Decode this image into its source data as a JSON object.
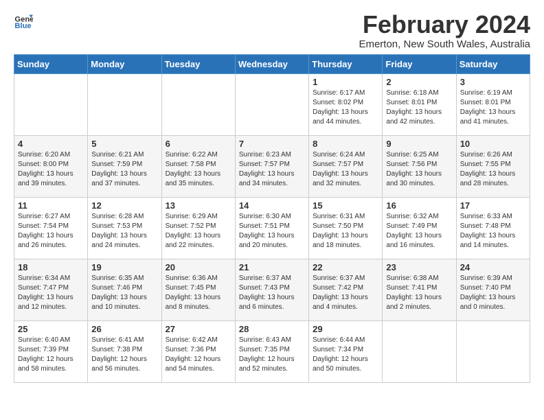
{
  "header": {
    "logo_general": "General",
    "logo_blue": "Blue",
    "month_title": "February 2024",
    "location": "Emerton, New South Wales, Australia"
  },
  "calendar": {
    "days_of_week": [
      "Sunday",
      "Monday",
      "Tuesday",
      "Wednesday",
      "Thursday",
      "Friday",
      "Saturday"
    ],
    "weeks": [
      [
        {
          "day": "",
          "info": ""
        },
        {
          "day": "",
          "info": ""
        },
        {
          "day": "",
          "info": ""
        },
        {
          "day": "",
          "info": ""
        },
        {
          "day": "1",
          "info": "Sunrise: 6:17 AM\nSunset: 8:02 PM\nDaylight: 13 hours\nand 44 minutes."
        },
        {
          "day": "2",
          "info": "Sunrise: 6:18 AM\nSunset: 8:01 PM\nDaylight: 13 hours\nand 42 minutes."
        },
        {
          "day": "3",
          "info": "Sunrise: 6:19 AM\nSunset: 8:01 PM\nDaylight: 13 hours\nand 41 minutes."
        }
      ],
      [
        {
          "day": "4",
          "info": "Sunrise: 6:20 AM\nSunset: 8:00 PM\nDaylight: 13 hours\nand 39 minutes."
        },
        {
          "day": "5",
          "info": "Sunrise: 6:21 AM\nSunset: 7:59 PM\nDaylight: 13 hours\nand 37 minutes."
        },
        {
          "day": "6",
          "info": "Sunrise: 6:22 AM\nSunset: 7:58 PM\nDaylight: 13 hours\nand 35 minutes."
        },
        {
          "day": "7",
          "info": "Sunrise: 6:23 AM\nSunset: 7:57 PM\nDaylight: 13 hours\nand 34 minutes."
        },
        {
          "day": "8",
          "info": "Sunrise: 6:24 AM\nSunset: 7:57 PM\nDaylight: 13 hours\nand 32 minutes."
        },
        {
          "day": "9",
          "info": "Sunrise: 6:25 AM\nSunset: 7:56 PM\nDaylight: 13 hours\nand 30 minutes."
        },
        {
          "day": "10",
          "info": "Sunrise: 6:26 AM\nSunset: 7:55 PM\nDaylight: 13 hours\nand 28 minutes."
        }
      ],
      [
        {
          "day": "11",
          "info": "Sunrise: 6:27 AM\nSunset: 7:54 PM\nDaylight: 13 hours\nand 26 minutes."
        },
        {
          "day": "12",
          "info": "Sunrise: 6:28 AM\nSunset: 7:53 PM\nDaylight: 13 hours\nand 24 minutes."
        },
        {
          "day": "13",
          "info": "Sunrise: 6:29 AM\nSunset: 7:52 PM\nDaylight: 13 hours\nand 22 minutes."
        },
        {
          "day": "14",
          "info": "Sunrise: 6:30 AM\nSunset: 7:51 PM\nDaylight: 13 hours\nand 20 minutes."
        },
        {
          "day": "15",
          "info": "Sunrise: 6:31 AM\nSunset: 7:50 PM\nDaylight: 13 hours\nand 18 minutes."
        },
        {
          "day": "16",
          "info": "Sunrise: 6:32 AM\nSunset: 7:49 PM\nDaylight: 13 hours\nand 16 minutes."
        },
        {
          "day": "17",
          "info": "Sunrise: 6:33 AM\nSunset: 7:48 PM\nDaylight: 13 hours\nand 14 minutes."
        }
      ],
      [
        {
          "day": "18",
          "info": "Sunrise: 6:34 AM\nSunset: 7:47 PM\nDaylight: 13 hours\nand 12 minutes."
        },
        {
          "day": "19",
          "info": "Sunrise: 6:35 AM\nSunset: 7:46 PM\nDaylight: 13 hours\nand 10 minutes."
        },
        {
          "day": "20",
          "info": "Sunrise: 6:36 AM\nSunset: 7:45 PM\nDaylight: 13 hours\nand 8 minutes."
        },
        {
          "day": "21",
          "info": "Sunrise: 6:37 AM\nSunset: 7:43 PM\nDaylight: 13 hours\nand 6 minutes."
        },
        {
          "day": "22",
          "info": "Sunrise: 6:37 AM\nSunset: 7:42 PM\nDaylight: 13 hours\nand 4 minutes."
        },
        {
          "day": "23",
          "info": "Sunrise: 6:38 AM\nSunset: 7:41 PM\nDaylight: 13 hours\nand 2 minutes."
        },
        {
          "day": "24",
          "info": "Sunrise: 6:39 AM\nSunset: 7:40 PM\nDaylight: 13 hours\nand 0 minutes."
        }
      ],
      [
        {
          "day": "25",
          "info": "Sunrise: 6:40 AM\nSunset: 7:39 PM\nDaylight: 12 hours\nand 58 minutes."
        },
        {
          "day": "26",
          "info": "Sunrise: 6:41 AM\nSunset: 7:38 PM\nDaylight: 12 hours\nand 56 minutes."
        },
        {
          "day": "27",
          "info": "Sunrise: 6:42 AM\nSunset: 7:36 PM\nDaylight: 12 hours\nand 54 minutes."
        },
        {
          "day": "28",
          "info": "Sunrise: 6:43 AM\nSunset: 7:35 PM\nDaylight: 12 hours\nand 52 minutes."
        },
        {
          "day": "29",
          "info": "Sunrise: 6:44 AM\nSunset: 7:34 PM\nDaylight: 12 hours\nand 50 minutes."
        },
        {
          "day": "",
          "info": ""
        },
        {
          "day": "",
          "info": ""
        }
      ]
    ]
  }
}
